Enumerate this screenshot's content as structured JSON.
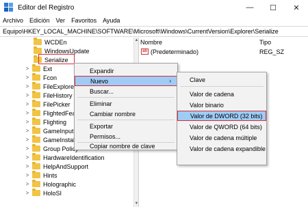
{
  "window": {
    "title": "Editor del Registro",
    "controls": {
      "minimize": "—",
      "maximize": "☐",
      "close": "✕"
    }
  },
  "menubar": [
    "Archivo",
    "Edición",
    "Ver",
    "Favoritos",
    "Ayuda"
  ],
  "address": "Equipo\\HKEY_LOCAL_MACHINE\\SOFTWARE\\Microsoft\\Windows\\CurrentVersion\\Explorer\\Serialize",
  "tree": [
    {
      "label": "WCDEn",
      "expander": ""
    },
    {
      "label": "WindowsUpdate",
      "expander": ""
    },
    {
      "label": "Serialize",
      "expander": ""
    },
    {
      "label": "Ext",
      "expander": ">"
    },
    {
      "label": "Fcon",
      "expander": ">"
    },
    {
      "label": "FileExplorer",
      "expander": ">"
    },
    {
      "label": "FileHistory",
      "expander": ">"
    },
    {
      "label": "FilePicker",
      "expander": ">"
    },
    {
      "label": "FlightedFeat",
      "expander": ">"
    },
    {
      "label": "Flighting",
      "expander": ">"
    },
    {
      "label": "GameInput",
      "expander": ">"
    },
    {
      "label": "GameInstalle",
      "expander": ">"
    },
    {
      "label": "Group Policy",
      "expander": ">"
    },
    {
      "label": "HardwareIdentification",
      "expander": ">"
    },
    {
      "label": "HelpAndSupport",
      "expander": ">"
    },
    {
      "label": "Hints",
      "expander": ">"
    },
    {
      "label": "Holographic",
      "expander": ">"
    },
    {
      "label": "HoloSI",
      "expander": ">"
    }
  ],
  "values_header": {
    "name": "Nombre",
    "type": "Tipo"
  },
  "values": [
    {
      "icon": "ab",
      "name": "(Predeterminado)",
      "type": "REG_SZ"
    }
  ],
  "context_menu": [
    {
      "label": "Expandir",
      "state": "normal"
    },
    {
      "label": "Nuevo",
      "state": "highlighted",
      "submenu": "›"
    },
    {
      "label": "Buscar...",
      "state": "normal"
    },
    {
      "label": "Eliminar",
      "state": "normal"
    },
    {
      "label": "Cambiar nombre",
      "state": "normal"
    },
    {
      "label": "Exportar",
      "state": "normal"
    },
    {
      "label": "Permisos...",
      "state": "normal"
    },
    {
      "label": "Copiar nombre de clave",
      "state": "normal"
    }
  ],
  "submenu": [
    {
      "label": "Clave"
    },
    {
      "label": "Valor de cadena"
    },
    {
      "label": "Valor binario"
    },
    {
      "label": "Valor de DWORD (32 bits)"
    },
    {
      "label": "Valor de QWORD (64 bits)"
    },
    {
      "label": "Valor de cadena múltiple"
    },
    {
      "label": "Valor de cadena expandible"
    }
  ],
  "colors": {
    "highlight": "#9fccf5",
    "annotation_red": "#d42c3a",
    "folder": "#f1c446"
  }
}
